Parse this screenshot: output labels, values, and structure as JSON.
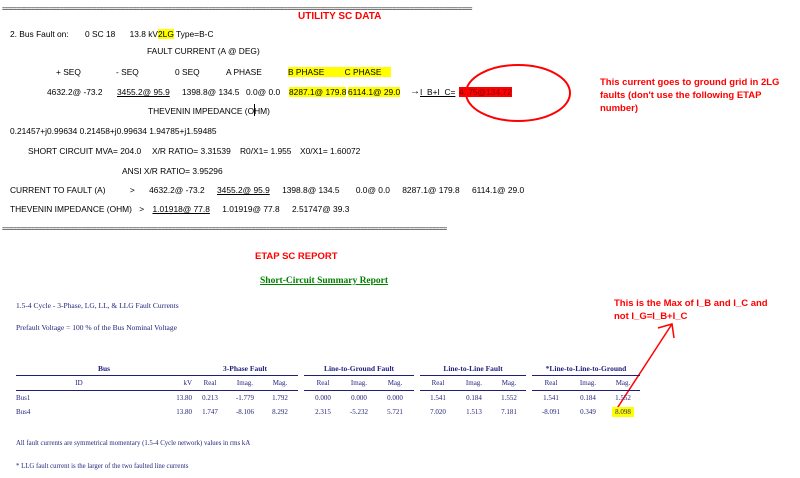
{
  "utility": {
    "title": "UTILITY SC DATA",
    "separator": "==================================================================================================================================",
    "fault_line": {
      "prefix": "2. Bus Fault on:",
      "bus": "0 SC 18",
      "kv": "13.8 kV",
      "type_hl": "2LG",
      "type_rest": "Type=B-C"
    },
    "fault_current_header": "FAULT CURRENT (A @ DEG)",
    "seq_headers": {
      "pos": "+ SEQ",
      "neg": "- SEQ",
      "zero": "0 SEQ",
      "a": "A PHASE",
      "b": "B PHASE",
      "c": "C PHASE"
    },
    "values": {
      "pos": "4632.2@ -73.2",
      "neg": "3455.2@  95.9",
      "zero": "1398.8@ 134.5",
      "a": "0.0@  0.0",
      "b": "8287.1@ 179.8",
      "c": "6114.1@  29.0"
    },
    "ibc_label": "I_B+I_C=",
    "ibc_value": "4175@134.72",
    "thevenin_header": "THEVENIN IMPEDANCE (OHM)",
    "thevenin_values": "0.21457+j0.99634   0.21458+j0.99634   1.94785+j1.59485",
    "sc_mva_line": {
      "mva": "SHORT CIRCUIT MVA=  204.0",
      "xr": "X/R RATIO=  3.31539",
      "r0x1": "R0/X1=  1.955",
      "x0x1": "X0/X1=  1.60072"
    },
    "ansi_xr": "ANSI X/R RATIO=  3.95296",
    "current_to_fault": {
      "label": "CURRENT TO FAULT (A)",
      "arrow": ">",
      "pos": "4632.2@ -73.2",
      "neg": "3455.2@  95.9",
      "zero": "1398.8@ 134.5",
      "a": "0.0@  0.0",
      "b": "8287.1@ 179.8",
      "c": "6114.1@  29.0"
    },
    "thevenin_final": {
      "label": "THEVENIN IMPEDANCE (OHM)",
      "arrow": ">",
      "v1": "1.01918@  77.8",
      "v2": "1.01919@  77.8",
      "v3": "2.51747@  39.3"
    },
    "separator2": "==========================================================================================================================="
  },
  "notes": {
    "ground_grid": "This current goes to ground grid in 2LG faults (don't use the following ETAP number)",
    "max_note": "This is the Max of I_B and I_C and not I_G=I_B+I_C"
  },
  "etap": {
    "title": "ETAP SC REPORT",
    "report_title": "Short-Circuit Summary Report",
    "cycle_line": "1.5-4 Cycle - 3-Phase, LG, LL, & LLG Fault Currents",
    "prefault": "Prefault Voltage  =   100 % of the Bus Nominal Voltage",
    "groups": {
      "bus": "Bus",
      "three_phase": "3-Phase Fault",
      "lg": "Line-to-Ground Fault",
      "ll": "Line-to-Line Fault",
      "llg": "*Line-to-Line-to-Ground"
    },
    "subheaders": {
      "id": "ID",
      "kv": "kV",
      "real": "Real",
      "imag": "Imag.",
      "mag": "Mag."
    },
    "rows": [
      {
        "id": "Bus1",
        "kv": "13.80",
        "v": [
          "0.213",
          "-1.779",
          "1.792",
          "0.000",
          "0.000",
          "0.000",
          "1.541",
          "0.184",
          "1.552",
          "1.541",
          "0.184",
          "1.552"
        ]
      },
      {
        "id": "Bus4",
        "kv": "13.80",
        "v": [
          "1.747",
          "-8.106",
          "8.292",
          "2.315",
          "-5.232",
          "5.721",
          "7.020",
          "1.513",
          "7.181",
          "-8.091",
          "0.349",
          "8.098"
        ]
      }
    ],
    "footnote1": "All fault currents are symmetrical momentary (1.5-4 Cycle network) values in rms kA",
    "footnote2": "* LLG fault current is the larger of the two faulted line currents"
  },
  "colors": {
    "red": "#ff0000",
    "yellow": "#ffff00",
    "green": "#008000",
    "navy": "#1f1f7a"
  }
}
